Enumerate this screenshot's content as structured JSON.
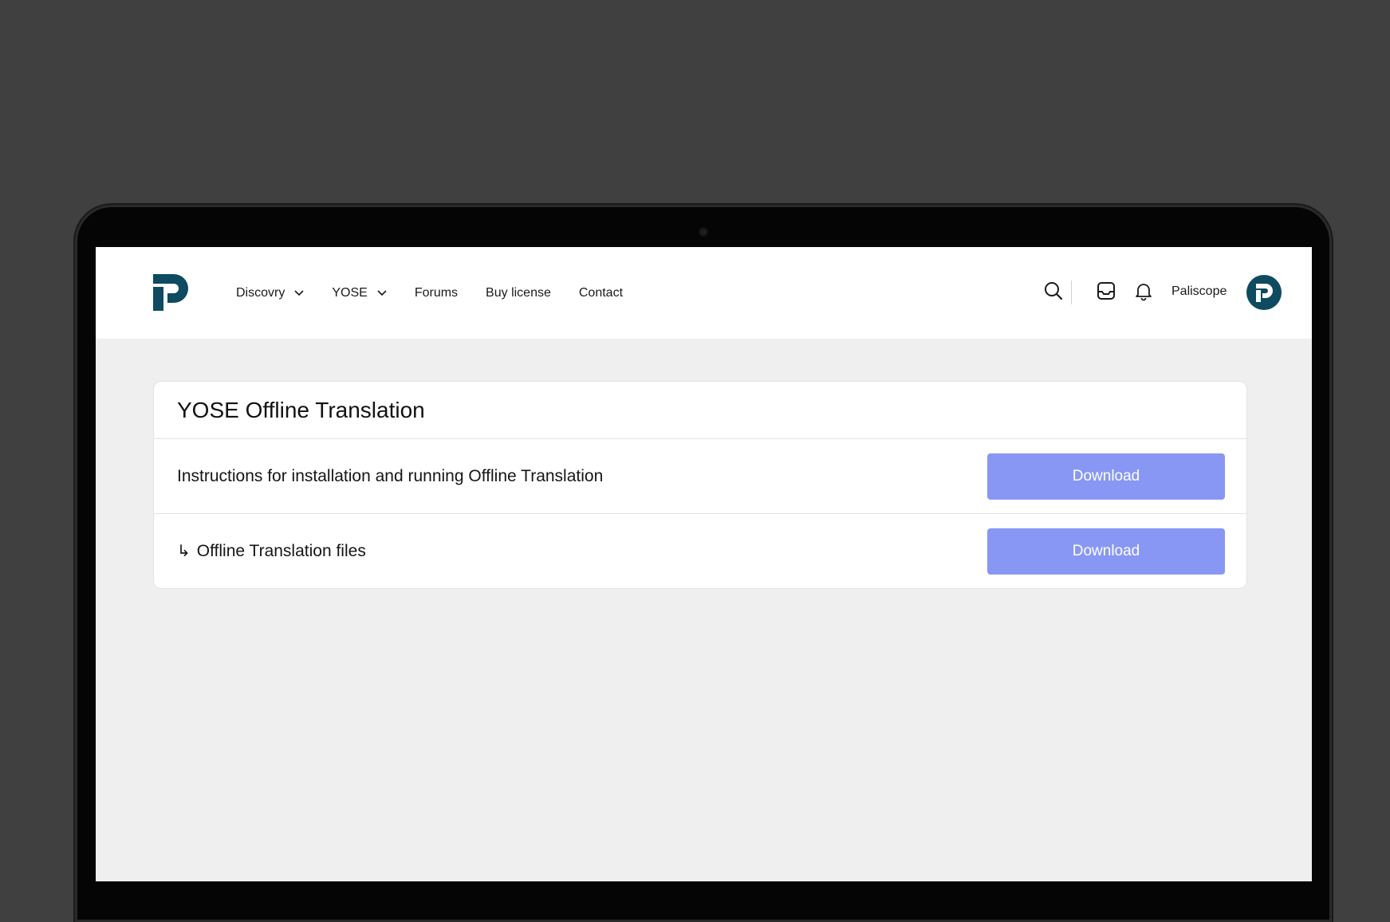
{
  "nav": {
    "items": [
      {
        "label": "Discovry",
        "has_dropdown": true
      },
      {
        "label": "YOSE",
        "has_dropdown": true
      },
      {
        "label": "Forums"
      },
      {
        "label": "Buy license"
      },
      {
        "label": "Contact"
      }
    ],
    "username": "Paliscope"
  },
  "card": {
    "title": "YOSE Offline Translation",
    "rows": [
      {
        "label": "Instructions for installation and running Offline Translation",
        "button": "Download"
      },
      {
        "arrow": "↳",
        "label": "Offline Translation files",
        "button": "Download"
      }
    ]
  },
  "colors": {
    "brand": "#0e4a60",
    "button": "#8897f4",
    "page_bg": "#efefef",
    "outer_bg": "#404040"
  },
  "icons": {
    "logo": "paliscope-logo",
    "search": "search-icon",
    "inbox": "inbox-icon",
    "notifications": "bell-icon"
  }
}
